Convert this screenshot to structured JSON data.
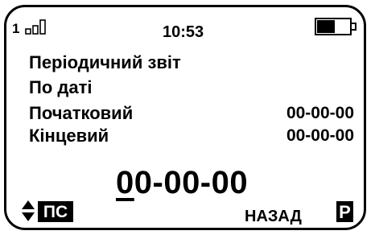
{
  "status": {
    "sim_number": "1",
    "time": "10:53",
    "signal_icon": "signal-strength-icon",
    "battery_icon": "battery-icon"
  },
  "menu": {
    "title": "Періодичний звіт",
    "subtitle": "По даті",
    "start_label": "Початковий",
    "start_value": "00-00-00",
    "end_label": "Кінцевий",
    "end_value": "00-00-00"
  },
  "input": {
    "cursor_char": "0",
    "rest": "0-00-00"
  },
  "softkeys": {
    "left_icon": "up-down-arrows-icon",
    "left_label": "ПС",
    "right_label": "НАЗАД",
    "right_key": "Р"
  }
}
